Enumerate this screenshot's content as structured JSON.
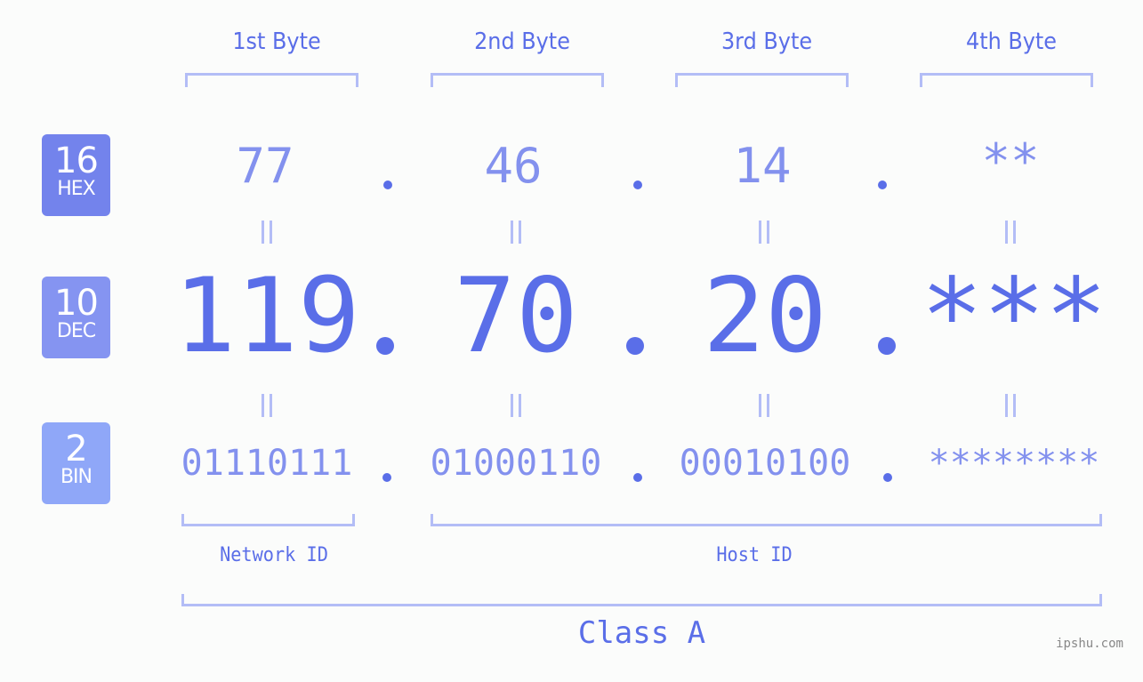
{
  "colors": {
    "accent": "#5a6ee8",
    "accent_light": "#8391ee",
    "bracket": "#b3bdf6",
    "badge_hex": "#7383ec",
    "badge_dec": "#8594f1",
    "badge_bin": "#8fa7f8",
    "background": "#fbfcfb"
  },
  "headers": [
    "1st Byte",
    "2nd Byte",
    "3rd Byte",
    "4th Byte"
  ],
  "badges": {
    "hex": {
      "num": "16",
      "label": "HEX"
    },
    "dec": {
      "num": "10",
      "label": "DEC"
    },
    "bin": {
      "num": "2",
      "label": "BIN"
    }
  },
  "hex": [
    "77",
    "46",
    "14",
    "**"
  ],
  "dec": [
    "119",
    "70",
    "20",
    "***"
  ],
  "bin": [
    "01110111",
    "01000110",
    "00010100",
    "********"
  ],
  "separator": ".",
  "equals_symbol": "=",
  "network_id_label": "Network ID",
  "host_id_label": "Host ID",
  "class_label": "Class A",
  "watermark": "ipshu.com"
}
